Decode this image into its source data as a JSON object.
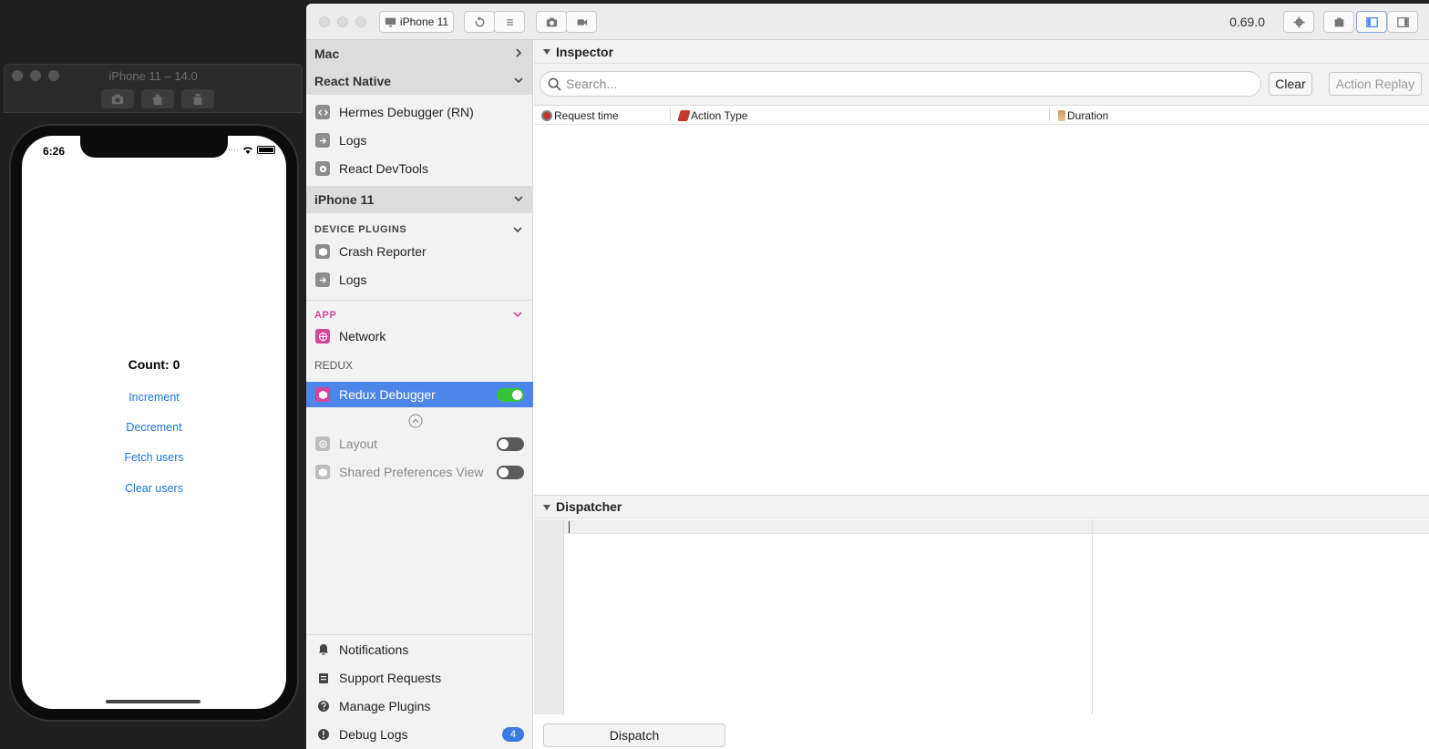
{
  "simulator": {
    "title": "iPhone 11 – 14.0",
    "time": "6:26",
    "count_label": "Count: 0",
    "buttons": [
      "Increment",
      "Decrement",
      "Fetch users",
      "Clear users"
    ]
  },
  "flipper": {
    "device_select": "iPhone 11",
    "version": "0.69.0",
    "sidebar": {
      "mac": "Mac",
      "react_native": "React Native",
      "rn_items": [
        "Hermes Debugger (RN)",
        "Logs",
        "React DevTools"
      ],
      "device": "iPhone 11",
      "device_plugins_label": "DEVICE PLUGINS",
      "device_plugins": [
        "Crash Reporter",
        "Logs"
      ],
      "app_label": "APP",
      "app_items": [
        "Network"
      ],
      "redux_label": "REDUX",
      "redux_item": "Redux Debugger",
      "disabled_items": [
        "Layout",
        "Shared Preferences Viewer"
      ],
      "bottom_items": [
        "Notifications",
        "Support Requests",
        "Manage Plugins",
        "Debug Logs"
      ],
      "debug_logs_badge": "4"
    },
    "inspector": {
      "title": "Inspector",
      "search_placeholder": "Search...",
      "clear_label": "Clear",
      "action_replay_label": "Action Replay",
      "columns": [
        "Request time",
        "Action Type",
        "Duration"
      ]
    },
    "dispatcher": {
      "title": "Dispatcher",
      "dispatch_label": "Dispatch"
    }
  },
  "colors": {
    "accent": "#4d86e8",
    "app_accent": "#d5459c",
    "toggle_on": "#35c23a",
    "link": "#1a73e8"
  }
}
